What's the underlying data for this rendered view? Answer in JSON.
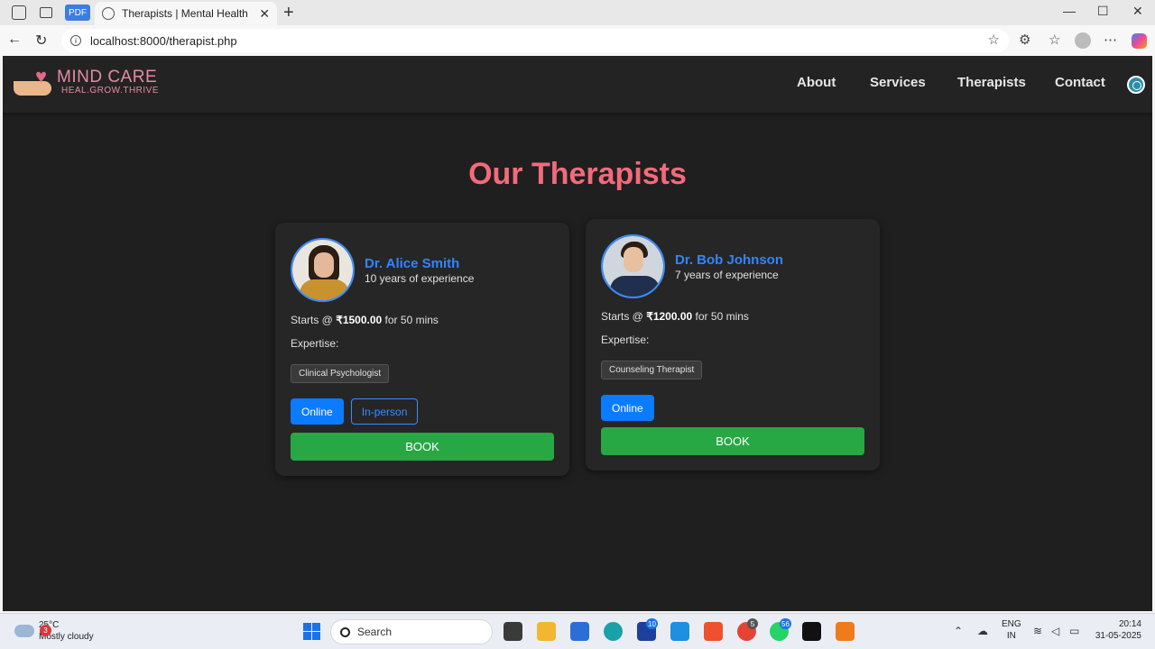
{
  "browser": {
    "pdf_badge": "PDF",
    "tab_title": "Therapists | Mental Health",
    "tab_close": "✕",
    "new_tab": "+",
    "minimize": "—",
    "maximize": "☐",
    "close": "✕",
    "back": "←",
    "reload": "↻",
    "url": "localhost:8000/therapist.php",
    "star": "☆",
    "extensions": "⚙",
    "favorites": "☆",
    "more": "⋯"
  },
  "site": {
    "brand_name": "MIND CARE",
    "tagline": "HEAL.GROW.THRIVE",
    "nav": [
      "About",
      "Services",
      "Therapists",
      "Contact"
    ]
  },
  "page": {
    "heading": "Our Therapists"
  },
  "therapists": [
    {
      "name": "Dr. Alice Smith",
      "experience": "10 years of experience",
      "price_prefix": "Starts @ ",
      "price": "₹1500.00",
      "price_suffix": " for 50 mins",
      "expertise_label": "Expertise:",
      "expertise": "Clinical Psychologist",
      "mode_online": "Online",
      "mode_inperson": "In-person",
      "book": "BOOK"
    },
    {
      "name": "Dr. Bob Johnson",
      "experience": "7 years of experience",
      "price_prefix": "Starts @ ",
      "price": "₹1200.00",
      "price_suffix": " for 50 mins",
      "expertise_label": "Expertise:",
      "expertise": "Counseling Therapist",
      "mode_online": "Online",
      "book": "BOOK"
    }
  ],
  "taskbar": {
    "weather_badge": "3",
    "temperature": "25°C",
    "condition": "Mostly cloudy",
    "search": "Search",
    "badge_l": "10",
    "badge_chrome": "5",
    "badge_whatsapp": "56",
    "lang": "ENG",
    "region": "IN",
    "time": "20:14",
    "date": "31-05-2025"
  },
  "colors": {
    "accent_heading": "#f26b7a",
    "name_blue": "#2f86ff",
    "book_green": "#28a745",
    "page_bg": "#1f1f1f"
  }
}
